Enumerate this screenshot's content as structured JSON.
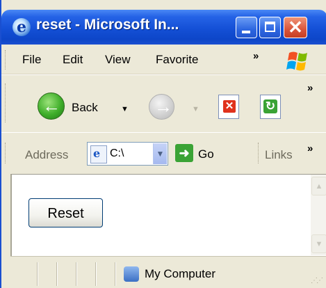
{
  "window": {
    "title": "reset - Microsoft In...",
    "buttons": {
      "minimize": "minimize",
      "maximize": "maximize",
      "close": "close"
    }
  },
  "menu": {
    "items": [
      "File",
      "Edit",
      "View",
      "Favorite"
    ],
    "overflow": "»"
  },
  "toolbar": {
    "back_label": "Back",
    "overflow": "»",
    "icons": [
      "back-icon",
      "forward-icon",
      "stop-icon",
      "refresh-icon"
    ]
  },
  "address": {
    "label": "Address",
    "value": "C:\\",
    "go_label": "Go",
    "links_label": "Links",
    "overflow": "»"
  },
  "content": {
    "reset_button_label": "Reset"
  },
  "status": {
    "zone_text": "My Computer"
  },
  "colors": {
    "titlebar": "#1450d6",
    "chrome": "#ece9d8",
    "close_button": "#d9543a",
    "go_green": "#3aa335"
  }
}
